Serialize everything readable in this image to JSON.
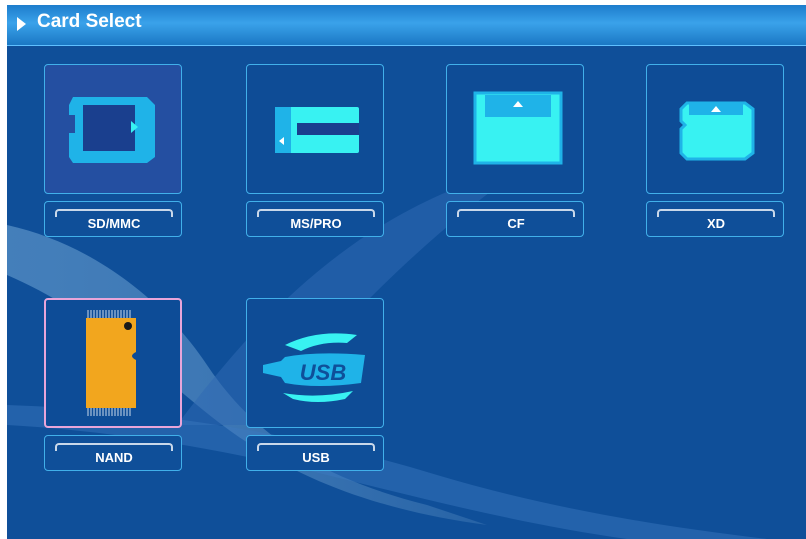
{
  "title_bar": {
    "title": "Card Select"
  },
  "cards": [
    {
      "id": "sdmmc",
      "label": "SD/MMC",
      "selected": false
    },
    {
      "id": "mspro",
      "label": "MS/PRO",
      "selected": false
    },
    {
      "id": "cf",
      "label": "CF",
      "selected": false
    },
    {
      "id": "xd",
      "label": "XD",
      "selected": false
    },
    {
      "id": "nand",
      "label": "NAND",
      "selected": true
    },
    {
      "id": "usb",
      "label": "USB",
      "selected": false,
      "logo_text": "USB"
    }
  ],
  "colors": {
    "background": "#0f4f99",
    "tile_border": "#41b0ea",
    "selection_border": "#e8a5d9",
    "card_icon": "#38f2f2",
    "nand_chip": "#f2a61e"
  }
}
